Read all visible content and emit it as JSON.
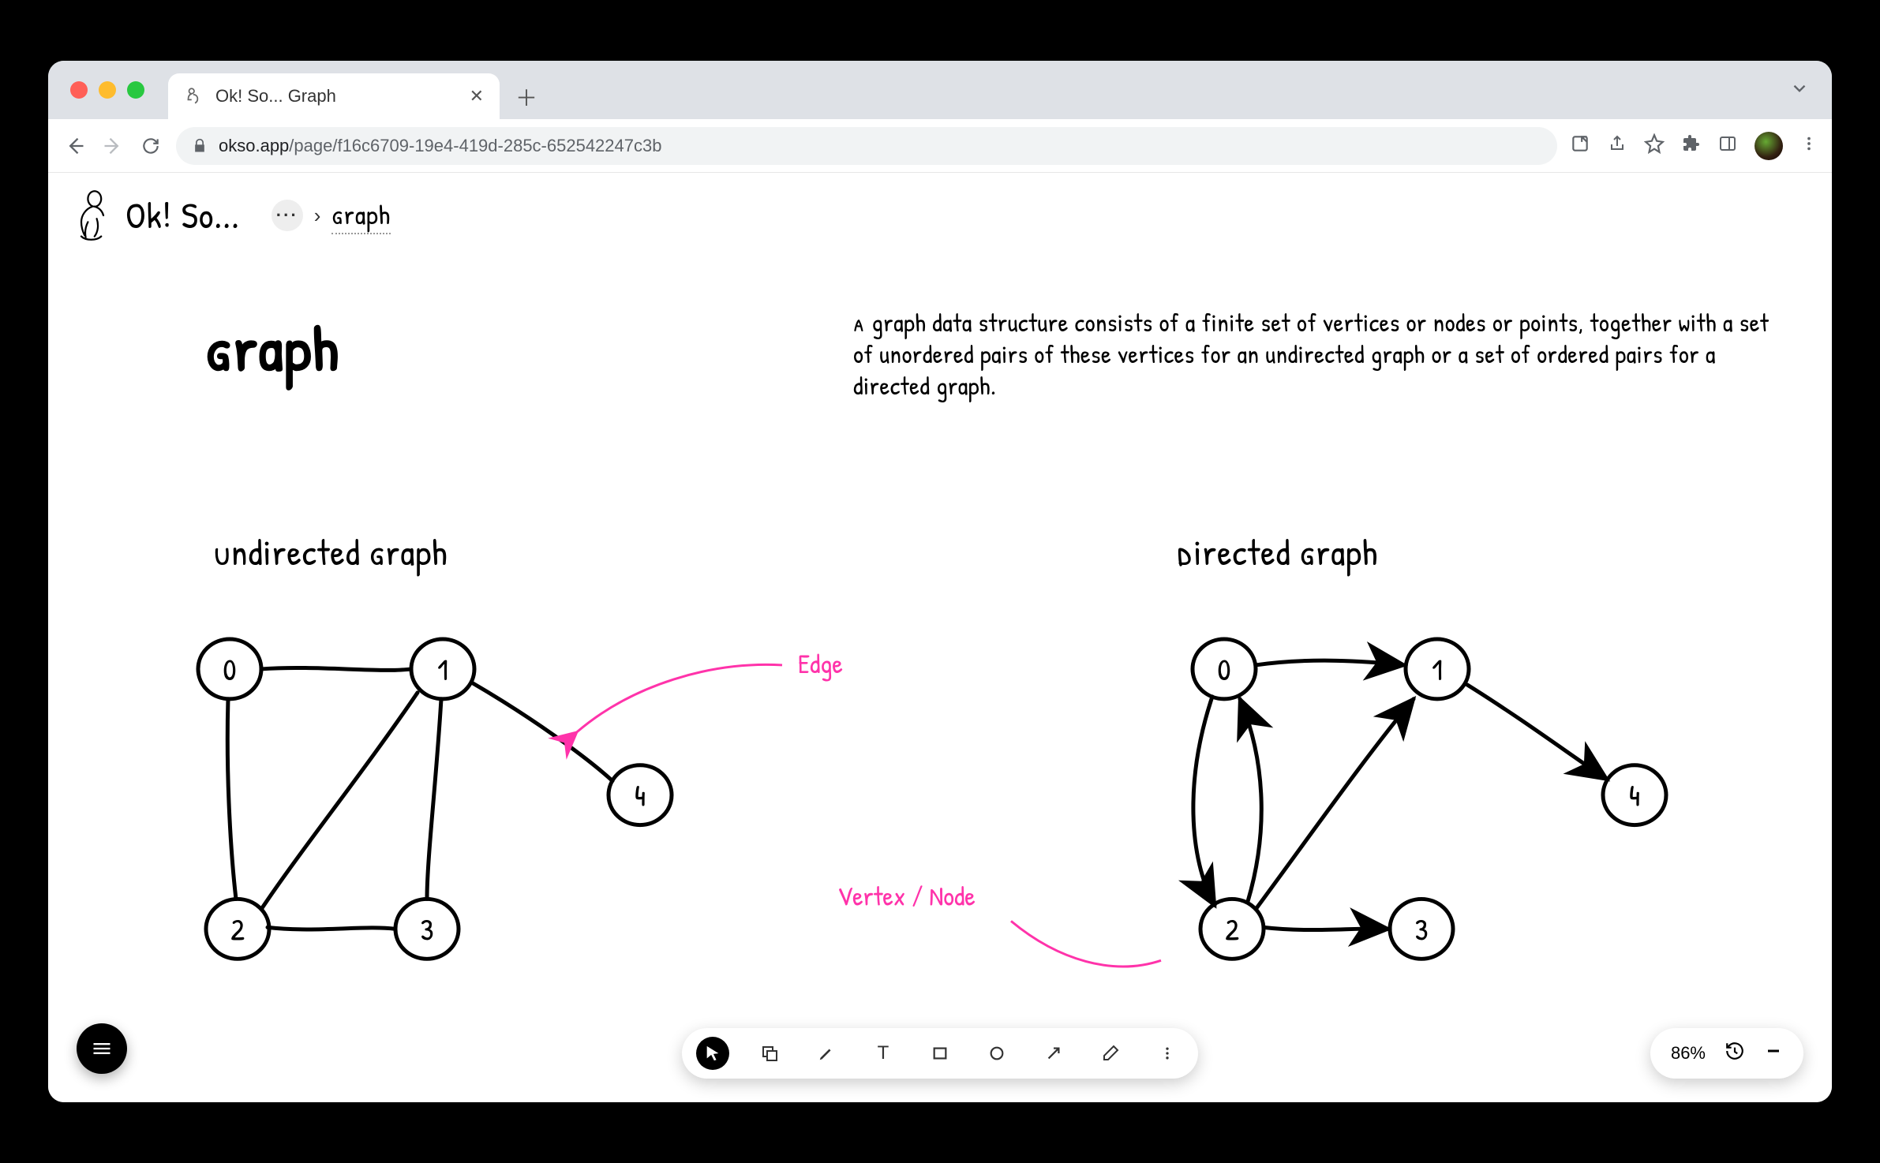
{
  "browser": {
    "tab_title": "Ok! So... Graph",
    "url_domain": "okso.app",
    "url_path": "/page/f16c6709-19e4-419d-285c-652542247c3b"
  },
  "app": {
    "name": "Ok! So...",
    "breadcrumb_current": "Graph"
  },
  "page": {
    "title": "Graph",
    "description": "A graph data structure consists of a finite set of vertices or nodes or points, together with a set of unordered pairs of these vertices for an undirected graph or a set of ordered pairs for a directed graph.",
    "section_left": "Undirected Graph",
    "section_right": "Directed Graph",
    "annotation_edge": "Edge",
    "annotation_vertex": "Vertex / Node"
  },
  "graph_data": {
    "undirected": {
      "nodes": [
        "0",
        "1",
        "2",
        "3",
        "4"
      ],
      "edges": [
        [
          "0",
          "1"
        ],
        [
          "0",
          "2"
        ],
        [
          "1",
          "2"
        ],
        [
          "1",
          "3"
        ],
        [
          "1",
          "4"
        ],
        [
          "2",
          "3"
        ]
      ]
    },
    "directed": {
      "nodes": [
        "0",
        "1",
        "2",
        "3",
        "4"
      ],
      "edges": [
        [
          "0",
          "1"
        ],
        [
          "0",
          "2"
        ],
        [
          "2",
          "0"
        ],
        [
          "2",
          "1"
        ],
        [
          "2",
          "3"
        ],
        [
          "1",
          "4"
        ]
      ]
    }
  },
  "toolbar": {
    "tools": [
      "select",
      "layers",
      "pen",
      "text",
      "rectangle",
      "ellipse",
      "arrow",
      "eraser",
      "more"
    ],
    "active_tool": "select"
  },
  "zoom": {
    "level": "86%"
  },
  "colors": {
    "accent_pink": "#ff33aa",
    "stroke": "#000000"
  }
}
